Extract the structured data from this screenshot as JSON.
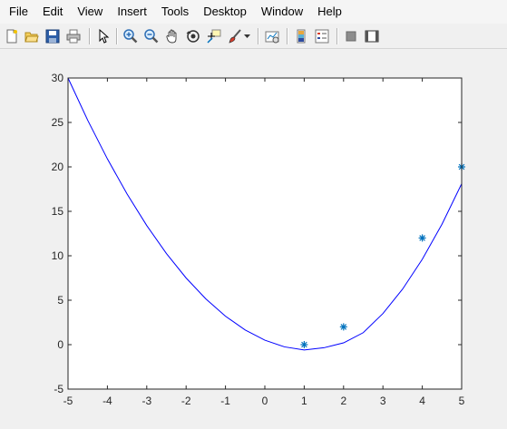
{
  "menu": {
    "items": [
      "File",
      "Edit",
      "View",
      "Insert",
      "Tools",
      "Desktop",
      "Window",
      "Help"
    ]
  },
  "toolbar": {
    "icons": [
      "new-figure-icon",
      "open-file-icon",
      "save-icon",
      "print-icon",
      "pointer-icon",
      "zoom-in-icon",
      "zoom-out-icon",
      "pan-icon",
      "rotate-3d-icon",
      "data-cursor-icon",
      "brush-icon",
      "brush-dropdown-icon",
      "link-plot-icon",
      "colorbar-icon",
      "legend-icon",
      "hide-plot-tools-icon",
      "show-plot-tools-icon"
    ]
  },
  "colors": {
    "curve": "#0000ff",
    "markers": "#0072bd",
    "axes": "#262626",
    "plot_bg": "#ffffff"
  },
  "chart_data": {
    "type": "line",
    "title": "",
    "xlabel": "",
    "ylabel": "",
    "xlim": [
      -5,
      5
    ],
    "ylim": [
      -5,
      30
    ],
    "x_ticks": [
      "-5",
      "-4",
      "-3",
      "-2",
      "-1",
      "0",
      "1",
      "2",
      "3",
      "4",
      "5"
    ],
    "y_ticks": [
      "-5",
      "0",
      "5",
      "10",
      "15",
      "20",
      "25",
      "30"
    ],
    "series": [
      {
        "style": "line",
        "color": "#0000ff",
        "x": [
          -5,
          -4.5,
          -4,
          -3.5,
          -3,
          -2.5,
          -2,
          -1.5,
          -1,
          -0.5,
          0,
          0.5,
          1,
          1.5,
          2,
          2.5,
          3,
          3.5,
          4,
          4.5,
          5
        ],
        "y": [
          30,
          25.25,
          20.9,
          16.95,
          13.4,
          10.25,
          7.5,
          5.15,
          3.2,
          1.65,
          0.5,
          -0.25,
          -0.6,
          -0.35,
          0.2,
          1.35,
          3.5,
          6.25,
          9.6,
          13.55,
          18.1
        ]
      },
      {
        "style": "markers",
        "marker": "asterisk",
        "color": "#0072bd",
        "x": [
          1,
          2,
          4,
          5
        ],
        "y": [
          0,
          2,
          12,
          20
        ]
      }
    ],
    "grid": false,
    "legend": "none"
  }
}
